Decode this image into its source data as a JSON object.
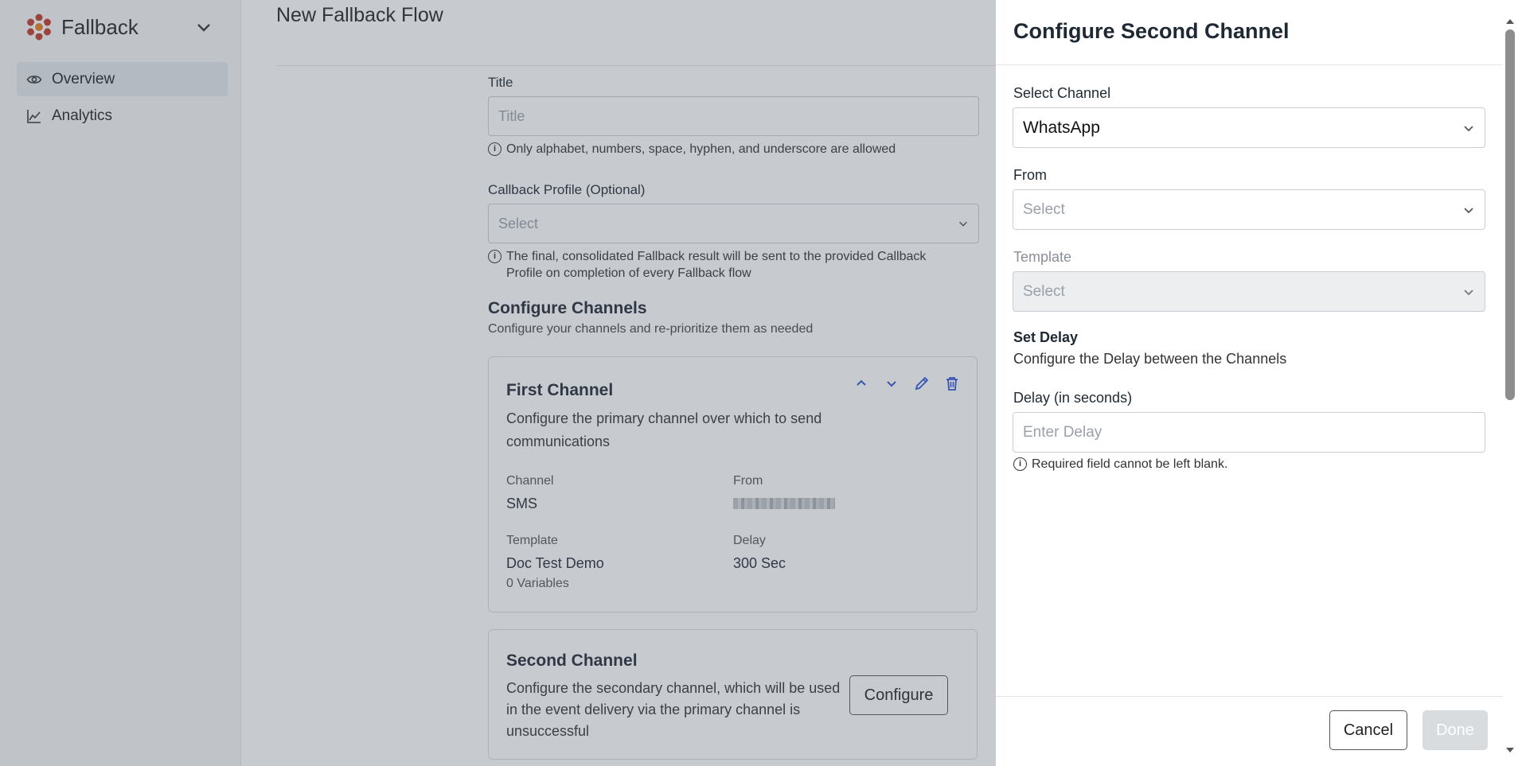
{
  "sidebar": {
    "brand": "Fallback",
    "items": [
      {
        "label": "Overview",
        "icon": "eye-icon",
        "active": true
      },
      {
        "label": "Analytics",
        "icon": "chart-line-icon",
        "active": false
      }
    ]
  },
  "main": {
    "page_title": "New Fallback Flow",
    "title_label": "Title",
    "title_placeholder": "Title",
    "title_hint": "Only alphabet, numbers, space, hyphen, and underscore are allowed",
    "callback_label": "Callback Profile (Optional)",
    "callback_placeholder": "Select",
    "callback_hint": "The final, consolidated Fallback result will be sent to the provided Callback Profile on completion of every Fallback flow",
    "channels_title": "Configure Channels",
    "channels_sub": "Configure your channels and re-prioritize them as needed",
    "first": {
      "title": "First Channel",
      "desc": "Configure the primary channel over which to send communications",
      "channel_label": "Channel",
      "channel_value": "SMS",
      "from_label": "From",
      "template_label": "Template",
      "template_value": "Doc Test Demo",
      "variables": "0 Variables",
      "delay_label": "Delay",
      "delay_value": "300 Sec"
    },
    "second": {
      "title": "Second Channel",
      "desc": "Configure the secondary channel, which will be used in the event delivery via the primary channel is unsuccessful",
      "button": "Configure"
    }
  },
  "panel": {
    "title": "Configure Second Channel",
    "select_channel_label": "Select Channel",
    "select_channel_value": "WhatsApp",
    "from_label": "From",
    "from_placeholder": "Select",
    "template_label": "Template",
    "template_placeholder": "Select",
    "set_delay_title": "Set Delay",
    "set_delay_sub": "Configure the Delay between the Channels",
    "delay_label": "Delay (in seconds)",
    "delay_placeholder": "Enter Delay",
    "delay_error": "Required field cannot be left blank.",
    "cancel": "Cancel",
    "done": "Done"
  },
  "colors": {
    "brand": "#c0392b",
    "action_icon": "#2f55d4",
    "overlay": "#505a69"
  }
}
